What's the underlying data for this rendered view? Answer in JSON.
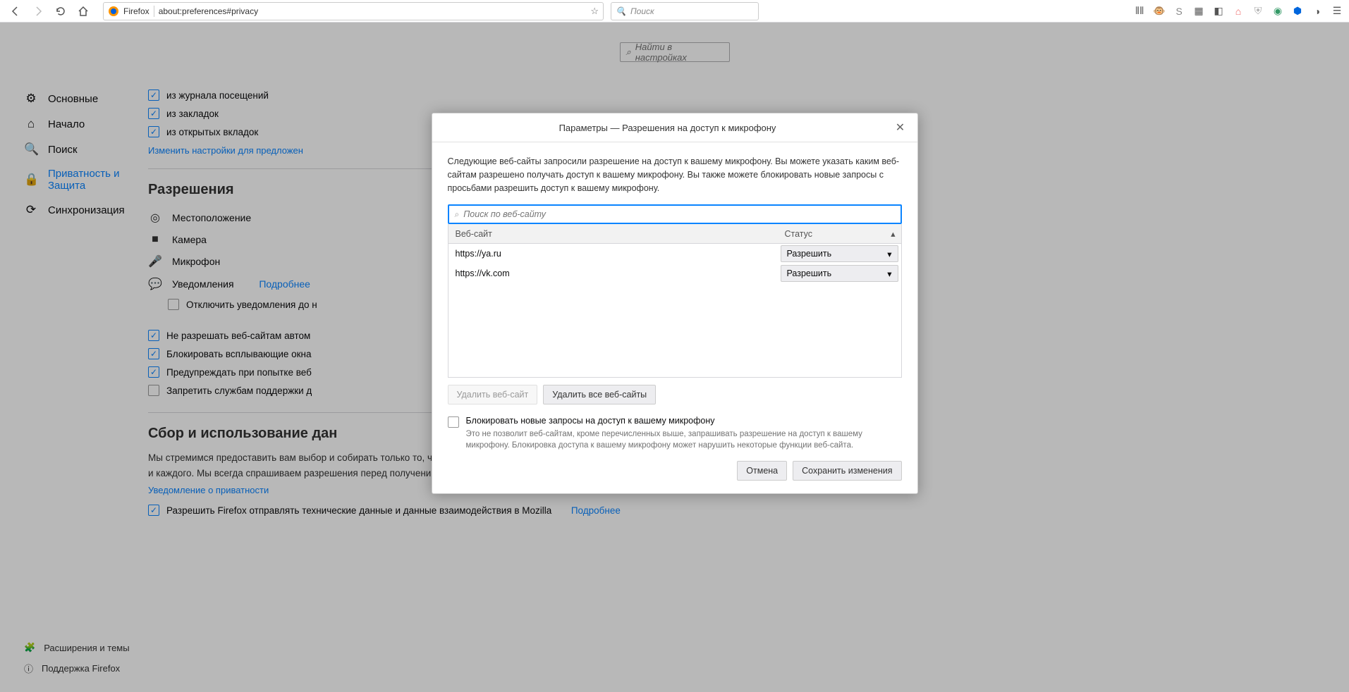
{
  "toolbar": {
    "firefox_label": "Firefox",
    "url": "about:preferences#privacy",
    "search_placeholder": "Поиск"
  },
  "settings_search_placeholder": "Найти в настройках",
  "sidebar": {
    "items": [
      {
        "label": "Основные"
      },
      {
        "label": "Начало"
      },
      {
        "label": "Поиск"
      },
      {
        "label": "Приватность и Защита"
      },
      {
        "label": "Синхронизация"
      }
    ],
    "bottom": [
      {
        "label": "Расширения и темы"
      },
      {
        "label": "Поддержка Firefox"
      }
    ]
  },
  "content": {
    "checks1": [
      "из журнала посещений",
      "из закладок",
      "из открытых вкладок"
    ],
    "suggestions_link": "Изменить настройки для предложен",
    "perms_title": "Разрешения",
    "perms": [
      "Местоположение",
      "Камера",
      "Микрофон",
      "Уведомления"
    ],
    "perms_more": "Подробнее",
    "disable_notif": "Отключить уведомления до н",
    "checks2": [
      "Не разрешать веб-сайтам автом",
      "Блокировать всплывающие окна",
      "Предупреждать при попытке веб"
    ],
    "checks2b": "Запретить службам поддержки д",
    "collection_title": "Сбор и использование дан",
    "collection_desc": "Мы стремимся предоставить вам выбор и собирать только то, что нам нужно, для выпуска и улучшения Firefox для всех и каждого. Мы всегда спрашиваем разрешения перед получением личной информации.",
    "privacy_link": "Уведомление о приватности",
    "telemetry": "Разрешить Firefox отправлять технические данные и данные взаимодействия в Mozilla",
    "more": "Подробнее"
  },
  "dialog": {
    "title": "Параметры — Разрешения на доступ к микрофону",
    "desc": "Следующие веб-сайты запросили разрешение на доступ к вашему микрофону. Вы можете указать каким веб-сайтам разрешено получать доступ к вашему микрофону. Вы также можете блокировать новые запросы с просьбами разрешить доступ к вашему микрофону.",
    "search_placeholder": "Поиск по веб-сайту",
    "th_site": "Веб-сайт",
    "th_status": "Статус",
    "rows": [
      {
        "site": "https://ya.ru",
        "status": "Разрешить"
      },
      {
        "site": "https://vk.com",
        "status": "Разрешить"
      }
    ],
    "remove_site": "Удалить веб-сайт",
    "remove_all": "Удалить все веб-сайты",
    "block_title": "Блокировать новые запросы на доступ к вашему микрофону",
    "block_desc": "Это не позволит веб-сайтам, кроме перечисленных выше, запрашивать разрешение на доступ к вашему микрофону. Блокировка доступа к вашему микрофону может нарушить некоторые функции веб-сайта.",
    "cancel": "Отмена",
    "save": "Сохранить изменения"
  }
}
